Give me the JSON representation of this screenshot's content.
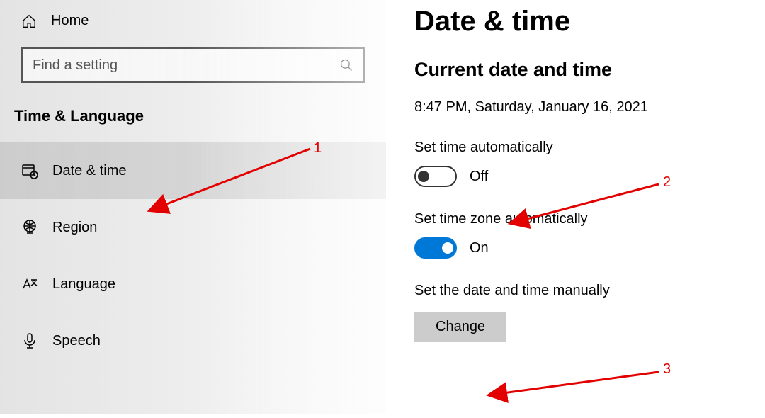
{
  "sidebar": {
    "home_label": "Home",
    "search_placeholder": "Find a setting",
    "category_title": "Time & Language",
    "items": [
      {
        "label": "Date & time"
      },
      {
        "label": "Region"
      },
      {
        "label": "Language"
      },
      {
        "label": "Speech"
      }
    ]
  },
  "main": {
    "page_title": "Date & time",
    "section_title": "Current date and time",
    "current_datetime": "8:47 PM, Saturday, January 16, 2021",
    "auto_time_label": "Set time automatically",
    "auto_time_state": "Off",
    "auto_tz_label": "Set time zone automatically",
    "auto_tz_state": "On",
    "manual_label": "Set the date and time manually",
    "change_button": "Change"
  },
  "annotations": {
    "n1": "1",
    "n2": "2",
    "n3": "3"
  }
}
